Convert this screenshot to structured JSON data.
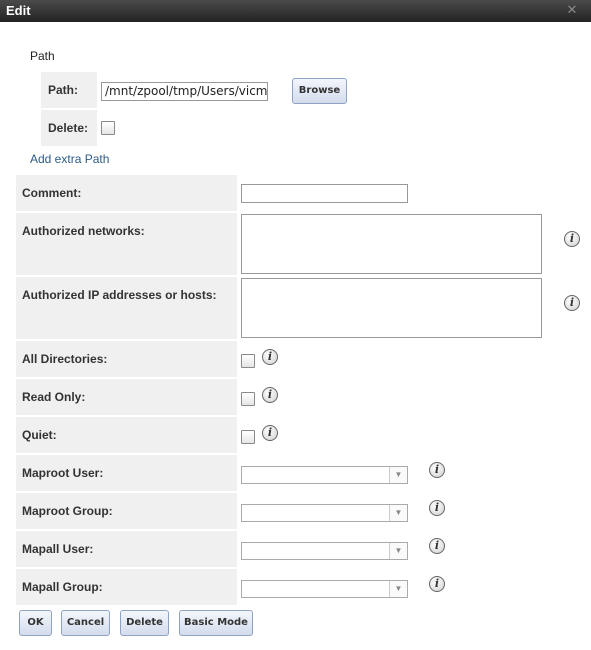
{
  "window": {
    "title": "Edit",
    "close_icon": "close-icon"
  },
  "path_section": {
    "legend": "Path",
    "path_label": "Path:",
    "path_value": "/mnt/zpool/tmp/Users/vicma",
    "browse_label": "Browse",
    "delete_label": "Delete:",
    "add_extra_path": "Add extra Path"
  },
  "form": {
    "comment_label": "Comment:",
    "comment_value": "",
    "authorized_networks_label": "Authorized networks:",
    "authorized_networks_value": "",
    "authorized_hosts_label": "Authorized IP addresses or hosts:",
    "authorized_hosts_value": "",
    "all_directories_label": "All Directories:",
    "read_only_label": "Read Only:",
    "quiet_label": "Quiet:",
    "maproot_user_label": "Maproot User:",
    "maproot_group_label": "Maproot Group:",
    "mapall_user_label": "Mapall User:",
    "mapall_group_label": "Mapall Group:"
  },
  "buttons": {
    "ok": "OK",
    "cancel": "Cancel",
    "delete": "Delete",
    "basic_mode": "Basic Mode"
  },
  "icons": {
    "info": "i",
    "dropdown": "▼",
    "close": "✕"
  },
  "colors": {
    "titlebar": "#2e2e2e",
    "label_bg": "#f0f0f0",
    "link": "#2d5c88",
    "button_border": "#8fa3c4"
  }
}
